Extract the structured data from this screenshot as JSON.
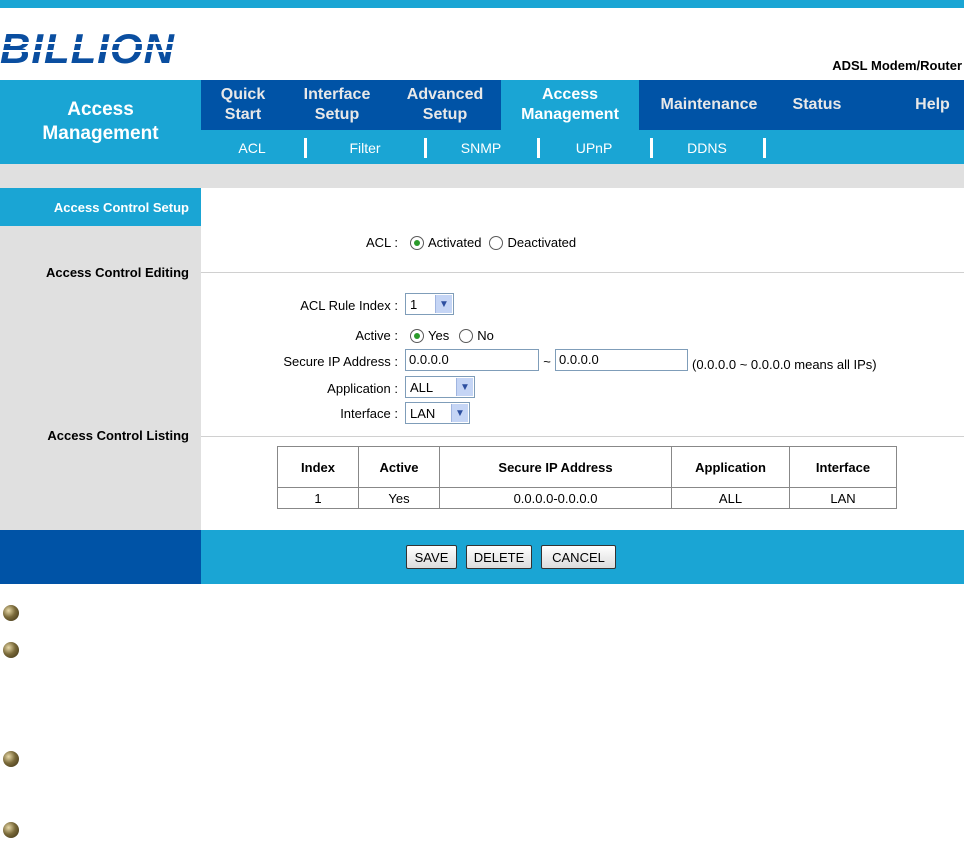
{
  "brand": {
    "logo_text": "BILLION",
    "product": "ADSL Modem/Router"
  },
  "section_title": "Access Management",
  "nav": [
    {
      "label": "Quick Start"
    },
    {
      "label": "Interface Setup"
    },
    {
      "label": "Advanced Setup"
    },
    {
      "label": "Access Management",
      "active": true
    },
    {
      "label": "Maintenance"
    },
    {
      "label": "Status"
    },
    {
      "label": "Help"
    }
  ],
  "subnav": [
    "ACL",
    "Filter",
    "SNMP",
    "UPnP",
    "DDNS"
  ],
  "left": {
    "setup": "Access Control Setup",
    "editing": "Access Control Editing",
    "listing": "Access Control Listing"
  },
  "acl": {
    "label": "ACL :",
    "activated": "Activated",
    "deactivated": "Deactivated",
    "selected": "Activated"
  },
  "form": {
    "rule_index_label": "ACL Rule Index :",
    "rule_index_value": "1",
    "active_label": "Active :",
    "yes": "Yes",
    "no": "No",
    "active_selected": "Yes",
    "secure_ip_label": "Secure IP Address :",
    "ip_from": "0.0.0.0",
    "tilde": "~",
    "ip_to": "0.0.0.0",
    "ip_hint": "(0.0.0.0 ~ 0.0.0.0 means all IPs)",
    "application_label": "Application :",
    "application_value": "ALL",
    "interface_label": "Interface :",
    "interface_value": "LAN"
  },
  "table": {
    "headers": [
      "Index",
      "Active",
      "Secure IP Address",
      "Application",
      "Interface"
    ],
    "rows": [
      [
        "1",
        "Yes",
        "0.0.0.0-0.0.0.0",
        "ALL",
        "LAN"
      ]
    ]
  },
  "buttons": {
    "save": "SAVE",
    "delete": "DELETE",
    "cancel": "CANCEL"
  },
  "colors": {
    "nav_dark": "#0053a6",
    "accent": "#1aa5d4",
    "panel_gray": "#e0e0e0"
  }
}
